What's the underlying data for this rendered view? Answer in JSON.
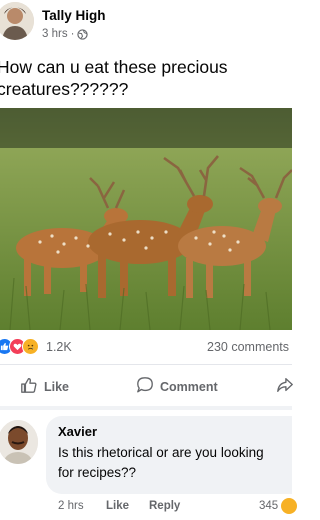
{
  "post": {
    "author": "Tally High",
    "time": "3 hrs",
    "separator": "·",
    "caption_line1": "How can u eat these precious",
    "caption_line2": "creatures??????",
    "photo_icon": "deer-photo"
  },
  "reactions": {
    "count": "1.2K",
    "comments": "230 comments",
    "icons": [
      "like-icon",
      "love-icon",
      "sad-icon"
    ]
  },
  "actions": {
    "like": "Like",
    "comment": "Comment",
    "share_icon": "share-icon"
  },
  "comment": {
    "author": "Xavier",
    "text": "Is this rhetorical or are you looking for recipes??",
    "time": "2 hrs",
    "like": "Like",
    "reply": "Reply",
    "reaction_count": "345"
  },
  "colors": {
    "like_blue": "#1877f2",
    "love_red": "#f33e58",
    "sad_yellow": "#f7b125",
    "secondary_text": "#65676b",
    "bubble_bg": "#f0f2f5"
  }
}
